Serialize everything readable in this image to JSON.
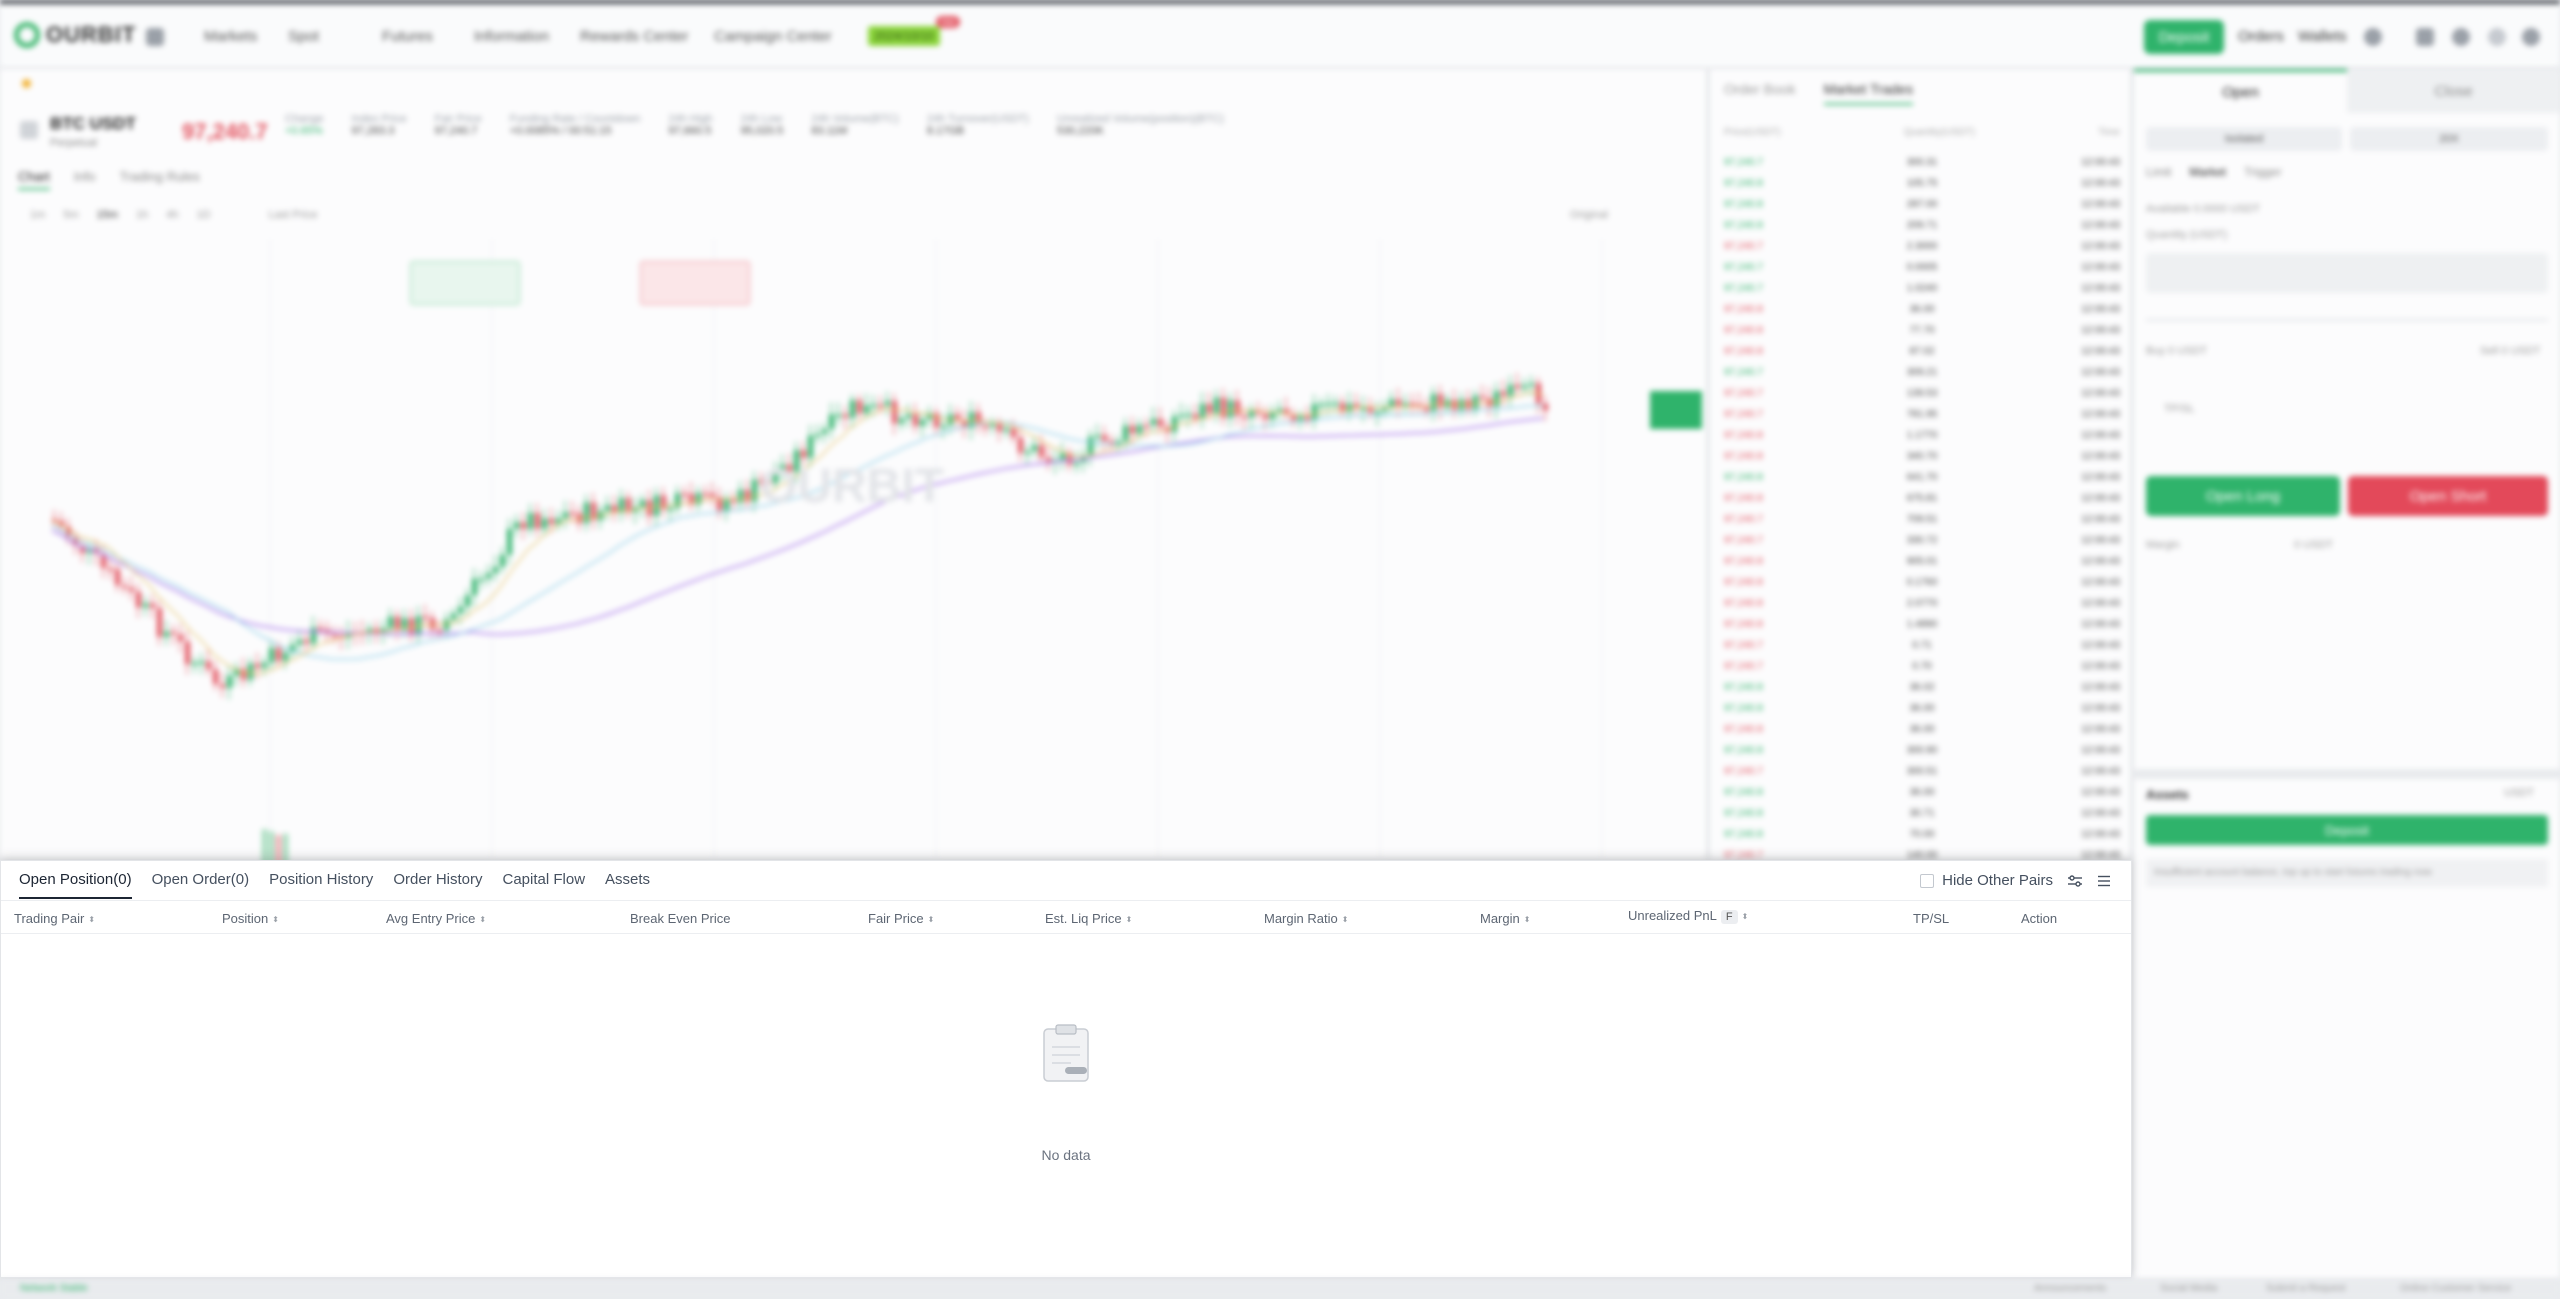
{
  "header": {
    "brand": "OURBIT",
    "nav": [
      "Markets",
      "Spot",
      "Futures",
      "Information",
      "Rewards Center",
      "Campaign Center"
    ],
    "promo": "2024/10/10",
    "promo_badge": "Hot",
    "deposit": "Deposit",
    "orders": "Orders",
    "wallets": "Wallets"
  },
  "ticker": {
    "symbol": "BTC USDT",
    "contract": "Perpetual",
    "last_price": "97,240.7",
    "stats": [
      {
        "label": "Change",
        "value": "+0.65%"
      },
      {
        "label": "Index Price",
        "value": "97,283.3"
      },
      {
        "label": "Fair Price",
        "value": "97,240.7"
      },
      {
        "label": "Funding Rate / Countdown",
        "value": "+0.0085% / 00:51:15"
      },
      {
        "label": "24h High",
        "value": "97,660.5"
      },
      {
        "label": "24h Low",
        "value": "95,020.5"
      },
      {
        "label": "24h Volume(BTC)",
        "value": "83.11M"
      },
      {
        "label": "24h Turnover(USDT)",
        "value": "8.17GB"
      },
      {
        "label": "Unrealized Volume(position)(BTC)",
        "value": "530,220K"
      }
    ],
    "tabs": [
      "Chart",
      "Info",
      "Trading Rules"
    ],
    "intervals": [
      "1m",
      "5m",
      "15m",
      "1h",
      "4h",
      "1D"
    ],
    "price_type": "Last Price",
    "view": "Original",
    "watermark": "OURBIT"
  },
  "orderbook": {
    "tabs": [
      "Order Book",
      "Market Trades"
    ],
    "headers": [
      "Price(USDT)",
      "Quantity(USDT)",
      "Time"
    ],
    "rows": [
      {
        "p": "97,240.7",
        "q": "300.31",
        "t": "12:00:43",
        "side": "g"
      },
      {
        "p": "97,240.8",
        "q": "105.75",
        "t": "12:00:43",
        "side": "g"
      },
      {
        "p": "97,240.8",
        "q": "287.00",
        "t": "12:00:43",
        "side": "g"
      },
      {
        "p": "97,240.8",
        "q": "209.71",
        "t": "12:00:43",
        "side": "g"
      },
      {
        "p": "97,240.7",
        "q": "2.3000",
        "t": "12:00:43",
        "side": "r"
      },
      {
        "p": "97,240.7",
        "q": "0.0005",
        "t": "12:00:43",
        "side": "g"
      },
      {
        "p": "97,240.7",
        "q": "1.0240",
        "t": "12:00:43",
        "side": "g"
      },
      {
        "p": "97,240.8",
        "q": "36.00",
        "t": "12:00:43",
        "side": "r"
      },
      {
        "p": "97,240.8",
        "q": "77.70",
        "t": "12:00:43",
        "side": "r"
      },
      {
        "p": "97,240.8",
        "q": "87.02",
        "t": "12:00:43",
        "side": "r"
      },
      {
        "p": "97,240.7",
        "q": "309.21",
        "t": "12:00:43",
        "side": "g"
      },
      {
        "p": "97,240.7",
        "q": "139.53",
        "t": "12:00:43",
        "side": "r"
      },
      {
        "p": "97,240.7",
        "q": "781.95",
        "t": "12:00:43",
        "side": "r"
      },
      {
        "p": "97,240.8",
        "q": "1.1770",
        "t": "12:00:43",
        "side": "r"
      },
      {
        "p": "97,240.8",
        "q": "340.70",
        "t": "12:00:43",
        "side": "r"
      },
      {
        "p": "97,240.8",
        "q": "641.70",
        "t": "12:00:43",
        "side": "g"
      },
      {
        "p": "97,240.8",
        "q": "675.81",
        "t": "12:00:43",
        "side": "r"
      },
      {
        "p": "97,240.7",
        "q": "709.51",
        "t": "12:00:43",
        "side": "r"
      },
      {
        "p": "97,240.7",
        "q": "330.72",
        "t": "12:00:43",
        "side": "r"
      },
      {
        "p": "97,240.8",
        "q": "905.01",
        "t": "12:00:43",
        "side": "r"
      },
      {
        "p": "97,240.8",
        "q": "0.1760",
        "t": "12:00:43",
        "side": "r"
      },
      {
        "p": "97,240.8",
        "q": "2.0770",
        "t": "12:00:43",
        "side": "r"
      },
      {
        "p": "97,240.8",
        "q": "1.4890",
        "t": "12:00:43",
        "side": "r"
      },
      {
        "p": "97,240.7",
        "q": "0.71",
        "t": "12:00:43",
        "side": "r"
      },
      {
        "p": "97,240.7",
        "q": "0.70",
        "t": "12:00:43",
        "side": "r"
      },
      {
        "p": "97,240.8",
        "q": "36.02",
        "t": "12:00:43",
        "side": "g"
      },
      {
        "p": "97,240.8",
        "q": "36.00",
        "t": "12:00:43",
        "side": "g"
      },
      {
        "p": "97,240.8",
        "q": "36.00",
        "t": "12:00:43",
        "side": "r"
      },
      {
        "p": "97,240.8",
        "q": "300.90",
        "t": "12:00:43",
        "side": "g"
      },
      {
        "p": "97,240.7",
        "q": "300.51",
        "t": "12:00:43",
        "side": "r"
      },
      {
        "p": "97,240.8",
        "q": "36.00",
        "t": "12:00:43",
        "side": "g"
      },
      {
        "p": "97,240.8",
        "q": "30.71",
        "t": "12:00:43",
        "side": "g"
      },
      {
        "p": "97,240.8",
        "q": "70.00",
        "t": "12:00:43",
        "side": "g"
      },
      {
        "p": "97,240.7",
        "q": "140.00",
        "t": "12:00:43",
        "side": "r"
      }
    ]
  },
  "trade": {
    "open": "Open",
    "close": "Close",
    "margin_mode": [
      "Isolated",
      "20X"
    ],
    "order_types": [
      "Limit",
      "Market",
      "Trigger"
    ],
    "available": "Available 0.0000 USDT",
    "quantity": "Quantity (USDT)",
    "buy": "Buy 0 USDT",
    "sell": "Sell 0 USDT",
    "tpsl": "TP/SL",
    "open_long": "Open Long",
    "open_short": "Open Short",
    "margin": "Margin",
    "margin_val": "0 USDT",
    "assets": "Assets",
    "assets_unit": "USDT",
    "deposit": "Deposit",
    "notice": "Insufficient account balance, top up to start futures trading now"
  },
  "positions": {
    "tabs": [
      "Open Position(0)",
      "Open Order(0)",
      "Position History",
      "Order History",
      "Capital Flow",
      "Assets"
    ],
    "hide_other_pairs": "Hide Other Pairs",
    "columns": [
      {
        "label": "Trading Pair",
        "sortable": true
      },
      {
        "label": "Position",
        "sortable": true
      },
      {
        "label": "Avg Entry Price",
        "sortable": true
      },
      {
        "label": "Break Even Price",
        "sortable": false
      },
      {
        "label": "Fair Price",
        "sortable": true
      },
      {
        "label": "Est. Liq Price",
        "sortable": true
      },
      {
        "label": "Margin Ratio",
        "sortable": true
      },
      {
        "label": "Margin",
        "sortable": true
      },
      {
        "label": "Unrealized PnL",
        "sortable": true,
        "badge": "F"
      },
      {
        "label": "TP/SL",
        "sortable": false
      },
      {
        "label": "Action",
        "sortable": false
      }
    ],
    "empty": "No data"
  },
  "footer": {
    "status": "Network Stable",
    "links": [
      "Announcements",
      "Social Media",
      "Submit a Request",
      "Online Customer Service"
    ]
  }
}
